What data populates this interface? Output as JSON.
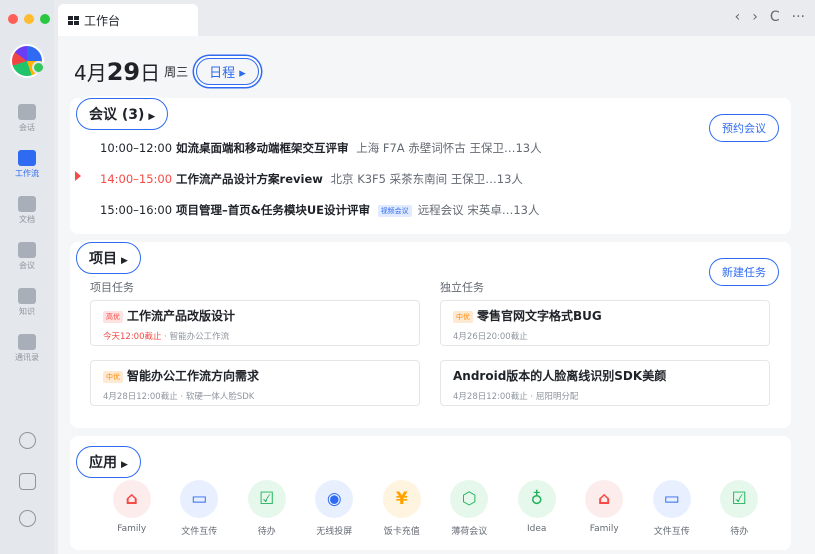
{
  "tab": {
    "title": "工作台"
  },
  "window_controls": [
    "‹",
    "›",
    "C",
    "···"
  ],
  "colors": {
    "accent": "#2f6bf2",
    "danger": "#f54a45",
    "warning": "#ff8800"
  },
  "nav": [
    {
      "label": "会话",
      "icon": "chat-icon"
    },
    {
      "label": "工作流",
      "icon": "workflow-icon",
      "active": true
    },
    {
      "label": "文档",
      "icon": "document-icon"
    },
    {
      "label": "会议",
      "icon": "video-icon"
    },
    {
      "label": "知识",
      "icon": "book-icon"
    },
    {
      "label": "通讯录",
      "icon": "contacts-icon"
    }
  ],
  "header": {
    "date_prefix": "4月",
    "day": "29",
    "date_suffix": "日",
    "weekday": "周三",
    "schedule_btn": "日程 ▸"
  },
  "meetings": {
    "title": "会议 (3)",
    "book_btn": "预约会议",
    "items": [
      {
        "time": "10:00–12:00",
        "title": "如流桌面端和移动端框架交互评审",
        "badge": "",
        "detail": "上海 F7A 赤壁词怀古   王保卫…13人"
      },
      {
        "time": "14:00–15:00",
        "title": "工作流产品设计方案review",
        "badge": "",
        "detail": "北京 K3F5 采茶东南间   王保卫…13人"
      },
      {
        "time": "15:00–16:00",
        "title": "项目管理–首页&任务模块UE设计评审",
        "badge": "视频会议",
        "detail": "远程会议   宋英卓…13人"
      }
    ]
  },
  "projects": {
    "title": "项目",
    "new_btn": "新建任务",
    "project_label": "项目任务",
    "solo_label": "独立任务",
    "project_tasks": [
      {
        "prio": "高优",
        "title": "工作流产品改版设计",
        "due": "今天12:00截止",
        "meta": " · 智能办公工作流"
      },
      {
        "prio": "中优",
        "title": "智能办公工作流方向需求",
        "due": "4月28日12:00截止",
        "meta": " · 软硬一体人脸SDK"
      }
    ],
    "solo_tasks": [
      {
        "prio": "中优",
        "title": "零售官网文字格式BUG",
        "due": "4月26日20:00截止",
        "meta": ""
      },
      {
        "prio": "",
        "title": "Android版本的人脸离线识别SDK美颜",
        "due": "4月28日12:00截止",
        "meta": " · 屈阳明分配"
      }
    ]
  },
  "apps": {
    "title": "应用",
    "items": [
      {
        "label": "Family",
        "icon": "home-icon",
        "glyph": "⌂",
        "color": "#f54a45",
        "bg": "#fdecec"
      },
      {
        "label": "文件互传",
        "icon": "transfer-icon",
        "glyph": "▭",
        "color": "#2f6bf2",
        "bg": "#e8f0ff"
      },
      {
        "label": "待办",
        "icon": "todo-icon",
        "glyph": "☑",
        "color": "#21b35b",
        "bg": "#e6f7ec"
      },
      {
        "label": "无线投屏",
        "icon": "cast-icon",
        "glyph": "◉",
        "color": "#2f6bf2",
        "bg": "#e8f0ff"
      },
      {
        "label": "饭卡充值",
        "icon": "yen-icon",
        "glyph": "¥",
        "color": "#ffa200",
        "bg": "#fff4df"
      },
      {
        "label": "薄荷会议",
        "icon": "mint-icon",
        "glyph": "⬡",
        "color": "#21b35b",
        "bg": "#e6f7ec"
      },
      {
        "label": "Idea",
        "icon": "bulb-icon",
        "glyph": "♁",
        "color": "#21b35b",
        "bg": "#e6f7ec"
      },
      {
        "label": "Family",
        "icon": "home-icon",
        "glyph": "⌂",
        "color": "#f54a45",
        "bg": "#fdecec"
      },
      {
        "label": "文件互传",
        "icon": "transfer-icon",
        "glyph": "▭",
        "color": "#2f6bf2",
        "bg": "#e8f0ff"
      },
      {
        "label": "待办",
        "icon": "todo-icon",
        "glyph": "☑",
        "color": "#21b35b",
        "bg": "#e6f7ec"
      }
    ]
  }
}
